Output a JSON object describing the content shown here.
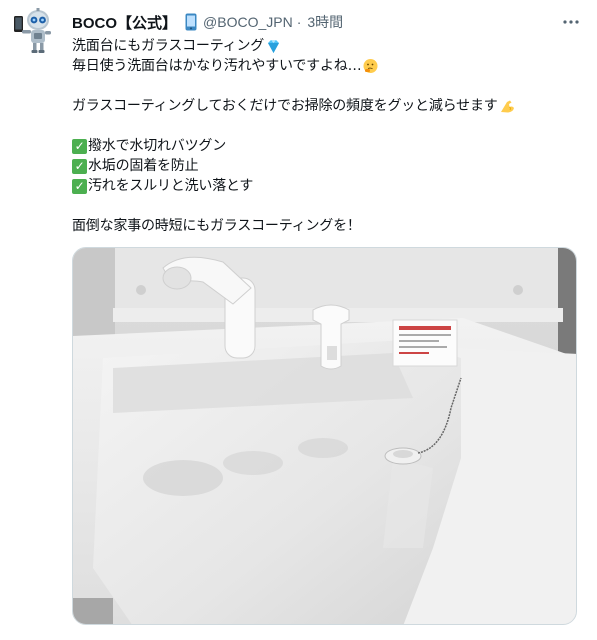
{
  "tweet": {
    "display_name": "BOCO【公式】",
    "handle": "@BOCO_JPN",
    "separator": "·",
    "timestamp": "3時間",
    "more_icon": "more-horizontal-icon",
    "lines": {
      "l1": "洗面台にもガラスコーティング",
      "l2": "毎日使う洗面台はかなり汚れやすいですよね…",
      "l3": "ガラスコーティングしておくだけでお掃除の頻度をグッと減らせます",
      "c1": "撥水で水切れバツグン",
      "c2": "水垢の固着を防止",
      "c3": "汚れをスルリと洗い落とす",
      "l4": "面倒な家事の時短にもガラスコーティングを！"
    },
    "emojis": {
      "after_name": "mobile-phone-icon",
      "after_l1": "gem-icon",
      "after_l2": "thinking-face-icon",
      "after_l3": "flexed-biceps-icon",
      "checkmark": "white-check-mark-icon"
    },
    "colors": {
      "text": "#0f1419",
      "secondary": "#536471",
      "border": "#cfd9de",
      "check_green": "#4caf50"
    }
  }
}
